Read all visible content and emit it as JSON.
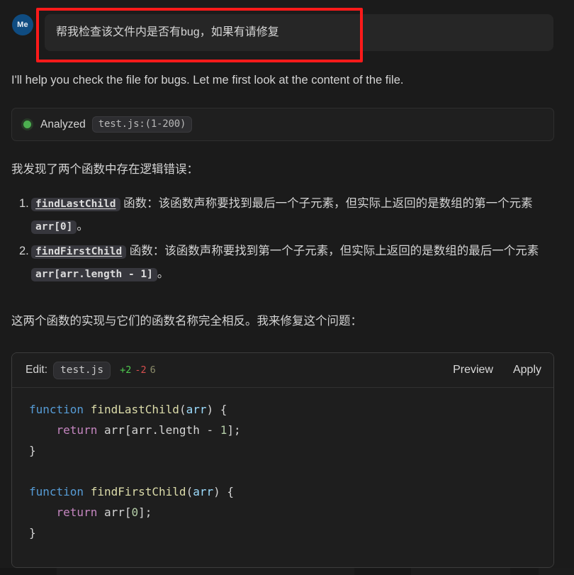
{
  "user_message": {
    "avatar_label": "Me",
    "text": "帮我检查该文件内是否有bug，如果有请修复"
  },
  "assistant": {
    "intro": "I'll help you check the file for bugs. Let me first look at the content of the file.",
    "findings_intro": "我发现了两个函数中存在逻辑错误：",
    "conclusion": "这两个函数的实现与它们的函数名称完全相反。我来修复这个问题："
  },
  "analyzed": {
    "status": "Analyzed",
    "file_range": "test.js:(1-200)",
    "dot_color": "#4caf50"
  },
  "findings": [
    {
      "number": "1.",
      "chip": "findLastChild",
      "text_before": " 函数：该函数声称要找到最后一个子元素，但实际上返回的是数组的第一个元素 ",
      "inline_code": "arr[0]",
      "text_after": "。"
    },
    {
      "number": "2.",
      "chip": "findFirstChild",
      "text_before": " 函数：该函数声称要找到第一个子元素，但实际上返回的是数组的最后一个元素 ",
      "inline_code": "arr[arr.length - 1]",
      "text_after": "。"
    }
  ],
  "edit_card": {
    "label": "Edit:",
    "file": "test.js",
    "additions": "+2",
    "deletions": "-2",
    "total": "6",
    "preview_label": "Preview",
    "apply_label": "Apply",
    "code_lines": [
      [
        {
          "t": "function",
          "c": "tok-kw"
        },
        {
          "t": " ",
          "c": "tok-punct"
        },
        {
          "t": "findLastChild",
          "c": "tok-fn"
        },
        {
          "t": "(",
          "c": "tok-punct"
        },
        {
          "t": "arr",
          "c": "tok-var"
        },
        {
          "t": ") {",
          "c": "tok-punct"
        }
      ],
      [
        {
          "t": "    ",
          "c": "tok-punct"
        },
        {
          "t": "return",
          "c": "tok-ctrl"
        },
        {
          "t": " arr[arr.length - ",
          "c": "tok-punct"
        },
        {
          "t": "1",
          "c": "tok-num"
        },
        {
          "t": "];",
          "c": "tok-punct"
        }
      ],
      [
        {
          "t": "}",
          "c": "tok-punct"
        }
      ],
      [
        {
          "t": "",
          "c": "tok-punct"
        }
      ],
      [
        {
          "t": "function",
          "c": "tok-kw"
        },
        {
          "t": " ",
          "c": "tok-punct"
        },
        {
          "t": "findFirstChild",
          "c": "tok-fn"
        },
        {
          "t": "(",
          "c": "tok-punct"
        },
        {
          "t": "arr",
          "c": "tok-var"
        },
        {
          "t": ") {",
          "c": "tok-punct"
        }
      ],
      [
        {
          "t": "    ",
          "c": "tok-punct"
        },
        {
          "t": "return",
          "c": "tok-ctrl"
        },
        {
          "t": " arr[",
          "c": "tok-punct"
        },
        {
          "t": "0",
          "c": "tok-num"
        },
        {
          "t": "];",
          "c": "tok-punct"
        }
      ],
      [
        {
          "t": "}",
          "c": "tok-punct"
        }
      ]
    ]
  },
  "annotation": {
    "color": "#ff1a1a"
  }
}
